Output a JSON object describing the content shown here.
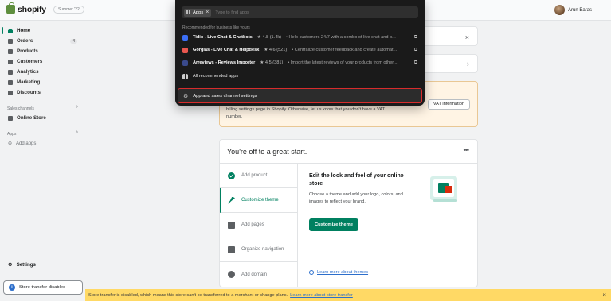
{
  "topbar": {
    "brand": "shopify",
    "edition": "Summer '22",
    "user_name": "Arun Baras"
  },
  "sidebar": {
    "items": [
      {
        "label": "Home",
        "icon": "home-icon"
      },
      {
        "label": "Orders",
        "icon": "orders-icon",
        "badge": "4"
      },
      {
        "label": "Products",
        "icon": "tag-icon"
      },
      {
        "label": "Customers",
        "icon": "person-icon"
      },
      {
        "label": "Analytics",
        "icon": "bar-chart-icon"
      },
      {
        "label": "Marketing",
        "icon": "target-icon"
      },
      {
        "label": "Discounts",
        "icon": "discount-icon"
      }
    ],
    "sales_channels_label": "Sales channels",
    "online_store": "Online Store",
    "apps_label": "Apps",
    "add_apps": "Add apps",
    "settings": "Settings",
    "store_transfer": "Store transfer disabled"
  },
  "apps_dropdown": {
    "chip_label": "Apps",
    "search_placeholder": "Type to find apps",
    "recommended_label": "Recommended for business like yours",
    "apps": [
      {
        "name": "Tidio - Live Chat & Chatbots",
        "rating": "★ 4.8 (1.4k)",
        "desc": "• Help customers 24/7 with a combo of live chat and b...",
        "color": "#3b6ef5"
      },
      {
        "name": "Gorgias - Live Chat & Helpdesk",
        "rating": "★ 4.6 (521)",
        "desc": "• Centralize customer feedback and create automat...",
        "color": "#e9574f"
      },
      {
        "name": "Arreviews - Reviews Importer",
        "rating": "★ 4.5 (381)",
        "desc": "• Import the latest reviews of your products from other...",
        "color": "#3a4a8c"
      }
    ],
    "all_recommended": "All recommended apps",
    "settings_link": "App and sales channel settings"
  },
  "warning_card": {
    "text": "billing settings page in Shopify. Otherwise, let us know that you don't have a VAT number.",
    "button": "VAT information"
  },
  "start_card": {
    "title": "You're off to a great start.",
    "steps": [
      {
        "label": "Add product",
        "icon": "check-circle-icon"
      },
      {
        "label": "Customize theme",
        "icon": "paintbrush-icon"
      },
      {
        "label": "Add pages",
        "icon": "pages-icon"
      },
      {
        "label": "Organize navigation",
        "icon": "navigation-icon"
      },
      {
        "label": "Add domain",
        "icon": "globe-icon"
      }
    ],
    "detail_title": "Edit the look and feel of your online store",
    "detail_text": "Choose a theme and add your logo, colors, and images to reflect your brand.",
    "cta": "Customize theme",
    "learn_more": "Learn more about themes"
  },
  "banner": {
    "text": "Store transfer is disabled, which means this store can't be transferred to a merchant or change plans.",
    "link": "Learn more about store transfer"
  },
  "colors": {
    "accent": "#008060",
    "highlight": "#d72c2c",
    "banner": "#ffd965"
  }
}
